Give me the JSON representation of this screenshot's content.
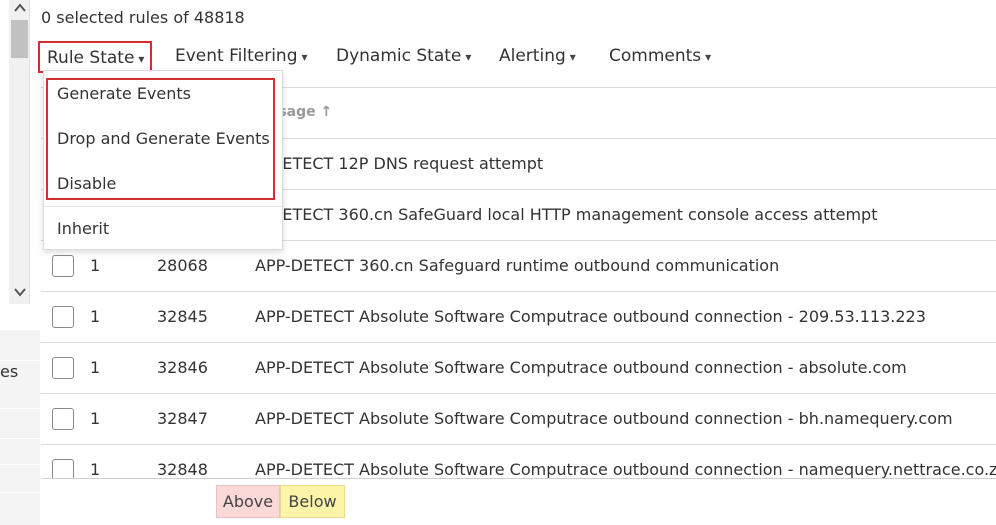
{
  "selection": {
    "count_text": "0 selected rules of 48818"
  },
  "toolbar": {
    "caret": "▾",
    "rule_state": "Rule State",
    "event_filtering": "Event Filtering",
    "dynamic_state": "Dynamic State",
    "alerting": "Alerting",
    "comments": "Comments"
  },
  "dropdown": {
    "options": [
      "Generate Events",
      "Drop and Generate Events",
      "Disable",
      "Inherit"
    ]
  },
  "table": {
    "header_message": "ssage ↑",
    "rows": [
      {
        "gid": "",
        "sid": "",
        "message": "P-DETECT 12P DNS request attempt"
      },
      {
        "gid": "",
        "sid": "",
        "message": "P-DETECT 360.cn SafeGuard local HTTP management console access attempt"
      },
      {
        "gid": "1",
        "sid": "28068",
        "message": "APP-DETECT 360.cn Safeguard runtime outbound communication"
      },
      {
        "gid": "1",
        "sid": "32845",
        "message": "APP-DETECT Absolute Software Computrace outbound connection - 209.53.113.223"
      },
      {
        "gid": "1",
        "sid": "32846",
        "message": "APP-DETECT Absolute Software Computrace outbound connection - absolute.com"
      },
      {
        "gid": "1",
        "sid": "32847",
        "message": "APP-DETECT Absolute Software Computrace outbound connection - bh.namequery.com"
      },
      {
        "gid": "1",
        "sid": "32848",
        "message": "APP-DETECT Absolute Software Computrace outbound connection - namequery.nettrace.co.za"
      }
    ]
  },
  "legend": {
    "above": "Above",
    "below": "Below"
  },
  "left_panel": {
    "fragment": "es"
  },
  "scrollbar": {
    "up_icon": "^",
    "down_icon": "v"
  },
  "colors": {
    "highlight_red": "#d32f2f",
    "above_bg": "#fcd9d9",
    "below_bg": "#fdf4a8"
  }
}
